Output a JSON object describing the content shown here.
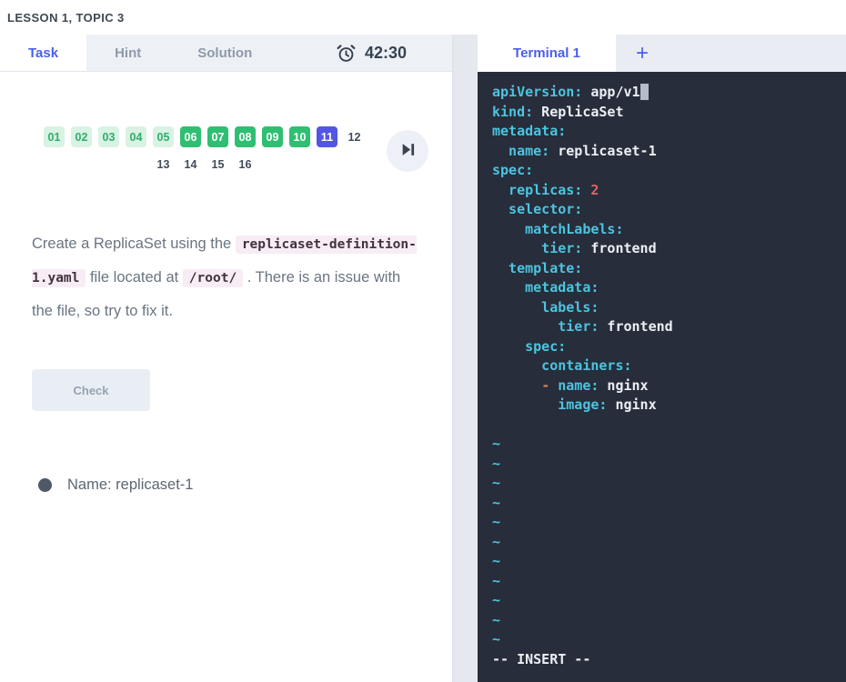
{
  "header": {
    "lesson_label": "LESSON 1, TOPIC 3"
  },
  "colors": {
    "accent_blue": "#4a5ef0",
    "step_green": "#2fbf72",
    "step_green_light": "#d9f2e4",
    "step_current": "#5356e2",
    "terminal_bg": "#272d3a",
    "yaml_key": "#4cc4e0",
    "yaml_value": "#eceff4",
    "yaml_number": "#e2606b",
    "yaml_dash": "#d8814f",
    "code_chip_bg": "#f8ecf5"
  },
  "left_panel": {
    "tabs": [
      {
        "label": "Task",
        "active": true
      },
      {
        "label": "Hint",
        "active": false
      },
      {
        "label": "Solution",
        "active": false
      }
    ],
    "timer": {
      "value": "42:30",
      "icon": "alarm-clock-icon"
    },
    "steps": [
      {
        "num": "01",
        "state": "done-light"
      },
      {
        "num": "02",
        "state": "done-light"
      },
      {
        "num": "03",
        "state": "done-light"
      },
      {
        "num": "04",
        "state": "done-light"
      },
      {
        "num": "05",
        "state": "done-light"
      },
      {
        "num": "06",
        "state": "done"
      },
      {
        "num": "07",
        "state": "done"
      },
      {
        "num": "08",
        "state": "done"
      },
      {
        "num": "09",
        "state": "done"
      },
      {
        "num": "10",
        "state": "done"
      },
      {
        "num": "11",
        "state": "current"
      },
      {
        "num": "12",
        "state": "todo"
      },
      {
        "num": "13",
        "state": "todo"
      },
      {
        "num": "14",
        "state": "todo"
      },
      {
        "num": "15",
        "state": "todo"
      },
      {
        "num": "16",
        "state": "todo"
      }
    ],
    "skip_button_icon": "skip-to-next-icon",
    "task_parts": [
      {
        "type": "text",
        "value": "Create a ReplicaSet using the "
      },
      {
        "type": "code",
        "value": "replicaset-definition-1.yaml"
      },
      {
        "type": "text",
        "value": " file located at "
      },
      {
        "type": "code",
        "value": "/root/"
      },
      {
        "type": "text",
        "value": " . There is an issue with the file, so try to fix it."
      }
    ],
    "check_button_label": "Check",
    "requirements": [
      {
        "label": "Name: replicaset-1"
      }
    ]
  },
  "terminal": {
    "tab_label": "Terminal 1",
    "new_tab_label": "+",
    "tilde_char": "~",
    "tilde_count": 11,
    "status_line": "-- INSERT --",
    "lines": [
      [
        {
          "c": "k",
          "t": "apiVersion:"
        },
        {
          "c": "v",
          "t": " app/v1"
        },
        {
          "c": "cur",
          "t": " "
        }
      ],
      [
        {
          "c": "k",
          "t": "kind:"
        },
        {
          "c": "v",
          "t": " ReplicaSet"
        }
      ],
      [
        {
          "c": "k",
          "t": "metadata:"
        }
      ],
      [
        {
          "c": "k",
          "t": "  name:"
        },
        {
          "c": "v",
          "t": " replicaset-1"
        }
      ],
      [
        {
          "c": "k",
          "t": "spec:"
        }
      ],
      [
        {
          "c": "k",
          "t": "  replicas:"
        },
        {
          "c": "n",
          "t": " 2"
        }
      ],
      [
        {
          "c": "k",
          "t": "  selector:"
        }
      ],
      [
        {
          "c": "k",
          "t": "    matchLabels:"
        }
      ],
      [
        {
          "c": "k",
          "t": "      tier:"
        },
        {
          "c": "v",
          "t": " frontend"
        }
      ],
      [
        {
          "c": "k",
          "t": "  template:"
        }
      ],
      [
        {
          "c": "k",
          "t": "    metadata:"
        }
      ],
      [
        {
          "c": "k",
          "t": "      labels:"
        }
      ],
      [
        {
          "c": "k",
          "t": "        tier:"
        },
        {
          "c": "v",
          "t": " frontend"
        }
      ],
      [
        {
          "c": "k",
          "t": "    spec:"
        }
      ],
      [
        {
          "c": "k",
          "t": "      containers:"
        }
      ],
      [
        {
          "c": "v",
          "t": "      "
        },
        {
          "c": "d",
          "t": "- "
        },
        {
          "c": "k",
          "t": "name:"
        },
        {
          "c": "v",
          "t": " nginx"
        }
      ],
      [
        {
          "c": "k",
          "t": "        image:"
        },
        {
          "c": "v",
          "t": " nginx"
        }
      ],
      []
    ]
  }
}
